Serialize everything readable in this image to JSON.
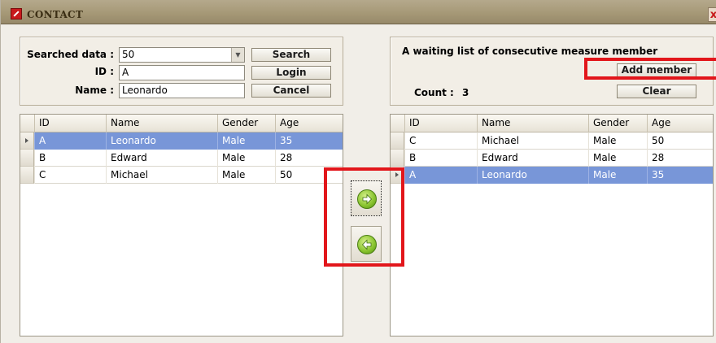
{
  "window": {
    "title": "CONTACT",
    "close_glyph": "x"
  },
  "search_panel": {
    "searched_data_label": "Searched data :",
    "searched_data_value": "50",
    "id_label": "ID :",
    "id_value": "A",
    "name_label": "Name :",
    "name_value": "Leonardo",
    "search_button": "Search",
    "login_button": "Login",
    "cancel_button": "Cancel"
  },
  "waiting_panel": {
    "title": "A waiting list of consecutive measure member",
    "add_member_button": "Add member",
    "count_label": "Count :",
    "count_value": "3",
    "clear_button": "Clear"
  },
  "columns": [
    "ID",
    "Name",
    "Gender",
    "Age"
  ],
  "left_grid": {
    "rows": [
      {
        "id": "A",
        "name": "Leonardo",
        "gender": "Male",
        "age": "35",
        "selected": true
      },
      {
        "id": "B",
        "name": "Edward",
        "gender": "Male",
        "age": "28",
        "selected": false
      },
      {
        "id": "C",
        "name": "Michael",
        "gender": "Male",
        "age": "50",
        "selected": false
      }
    ]
  },
  "right_grid": {
    "rows": [
      {
        "id": "C",
        "name": "Michael",
        "gender": "Male",
        "age": "50",
        "selected": false
      },
      {
        "id": "B",
        "name": "Edward",
        "gender": "Male",
        "age": "28",
        "selected": false
      },
      {
        "id": "A",
        "name": "Leonardo",
        "gender": "Male",
        "age": "35",
        "selected": true
      }
    ]
  },
  "transfer_buttons": {
    "move_right_icon": "arrow-right-icon",
    "move_left_icon": "arrow-left-icon"
  },
  "colors": {
    "selection": "#7896d8",
    "highlight": "#e2161b",
    "accent_green": "#86c22c"
  }
}
